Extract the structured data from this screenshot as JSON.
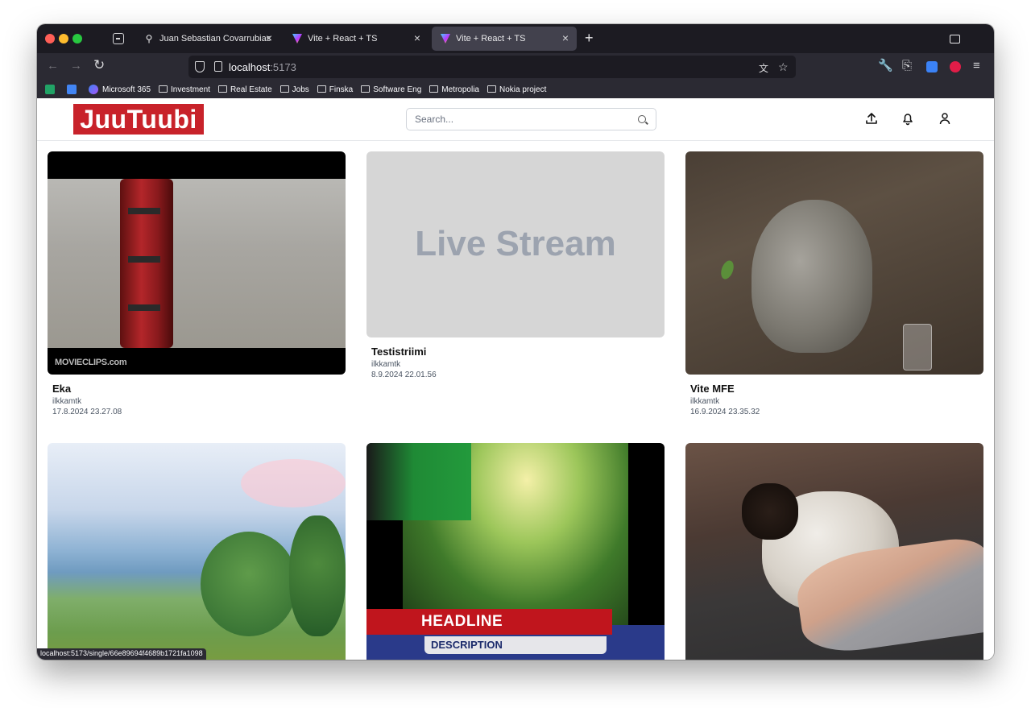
{
  "browser": {
    "tabs": [
      {
        "label": "Juan Sebastian Covarrubias",
        "close": "×"
      },
      {
        "label": "Vite + React + TS",
        "close": "×"
      },
      {
        "label": "Vite + React + TS",
        "close": "×"
      }
    ],
    "new_tab": "+",
    "url_host": "localhost",
    "url_port": ":5173",
    "bookmarks": [
      "Microsoft 365",
      "Investment",
      "Real Estate",
      "Jobs",
      "Finska",
      "Software Eng",
      "Metropolia",
      "Nokia project"
    ],
    "status_url": "localhost:5173/single/66e89694f4689b1721fa1098"
  },
  "app": {
    "logo": "JuuTuubi",
    "search_placeholder": "Search...",
    "cards": [
      {
        "title": "Eka",
        "user": "ilkkamtk",
        "date": "17.8.2024 23.27.08",
        "watermark": "MOVIECLIPS.com"
      },
      {
        "title": "Testistriimi",
        "user": "ilkkamtk",
        "date": "8.9.2024 22.01.56",
        "placeholder": "Live Stream"
      },
      {
        "title": "Vite MFE",
        "user": "ilkkamtk",
        "date": "16.9.2024 23.35.32"
      },
      {
        "overlay_headline": "HEADLINE",
        "overlay_description": "DESCRIPTION"
      }
    ]
  },
  "colors": {
    "brand": "#c8222a",
    "tab_bg": "#1c1b22",
    "toolbar_bg": "#2b2a33"
  }
}
